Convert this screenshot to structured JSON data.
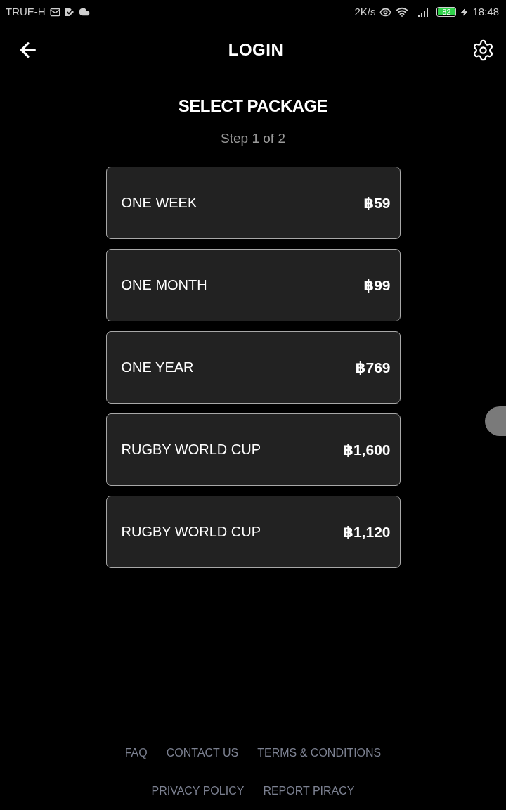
{
  "status_bar": {
    "carrier": "TRUE-H",
    "network_speed": "2K/s",
    "battery": "82",
    "time": "18:48"
  },
  "header": {
    "title": "LOGIN"
  },
  "page": {
    "title": "SELECT PACKAGE",
    "step": "Step 1 of 2"
  },
  "packages": [
    {
      "name": "ONE WEEK",
      "price": "฿59"
    },
    {
      "name": "ONE MONTH",
      "price": "฿99"
    },
    {
      "name": "ONE YEAR",
      "price": "฿769"
    },
    {
      "name": "RUGBY WORLD CUP",
      "price": "฿1,600"
    },
    {
      "name": "RUGBY WORLD CUP",
      "price": "฿1,120"
    }
  ],
  "footer": {
    "rows": [
      {
        "links": [
          "FAQ",
          "CONTACT US",
          "TERMS & CONDITIONS"
        ]
      },
      {
        "links": [
          "PRIVACY POLICY",
          "REPORT PIRACY"
        ]
      }
    ]
  }
}
